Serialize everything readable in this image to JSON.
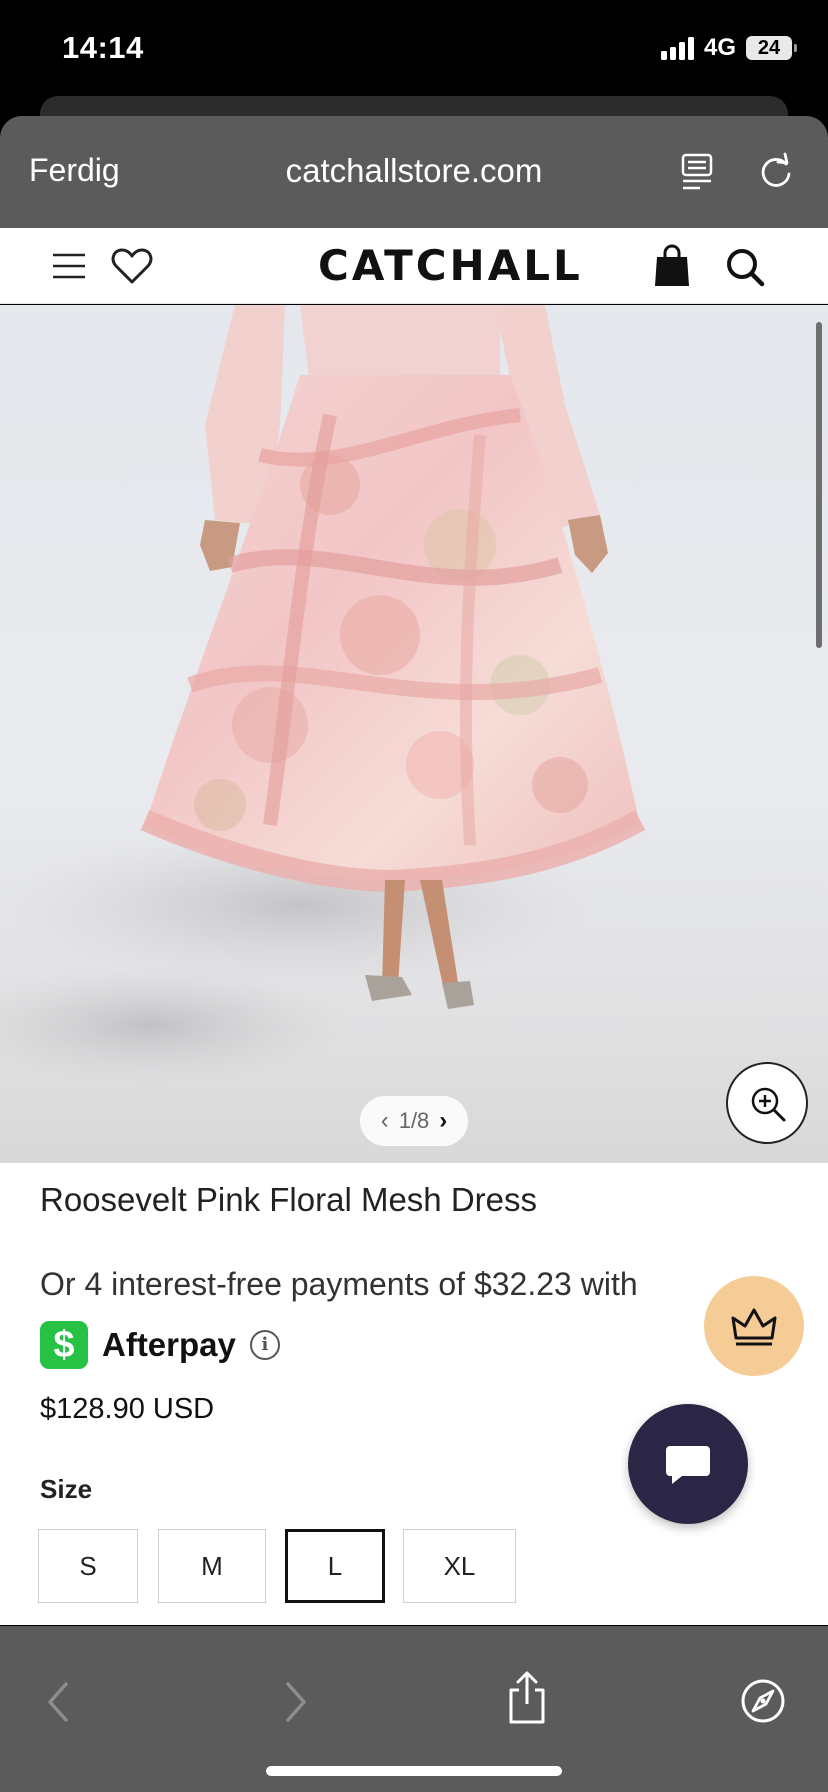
{
  "status_bar": {
    "time": "14:14",
    "network": "4G",
    "battery": "24"
  },
  "browser": {
    "done_label": "Ferdig",
    "url": "catchallstore.com",
    "icons": [
      "reader-icon",
      "reload-icon"
    ]
  },
  "store_header": {
    "logo": "CATCHALL",
    "icons": [
      "menu-icon",
      "heart-icon",
      "bag-icon",
      "search-icon"
    ]
  },
  "gallery": {
    "pager": "1/8",
    "zoom_icon": "zoom-in-icon"
  },
  "product": {
    "title": "Roosevelt Pink Floral Mesh Dress",
    "installments": "Or 4 interest-free payments of $32.23 with",
    "afterpay_label": "Afterpay",
    "cash_icon_glyph": "$",
    "info_glyph": "i",
    "price": "$128.90 USD",
    "size_label": "Size",
    "sizes": [
      "S",
      "M",
      "L",
      "XL"
    ],
    "selected_size": "L"
  },
  "floating": {
    "rewards_icon": "crown-icon",
    "chat_icon": "chat-icon"
  },
  "toolbar": {
    "icons": [
      "back-icon",
      "forward-icon",
      "share-icon",
      "compass-icon"
    ]
  },
  "colors": {
    "browser_chrome": "#5b5b5b",
    "afterpay_green": "#27c244",
    "rewards_bg": "#f5cb96",
    "chat_bg": "#2b2646"
  }
}
